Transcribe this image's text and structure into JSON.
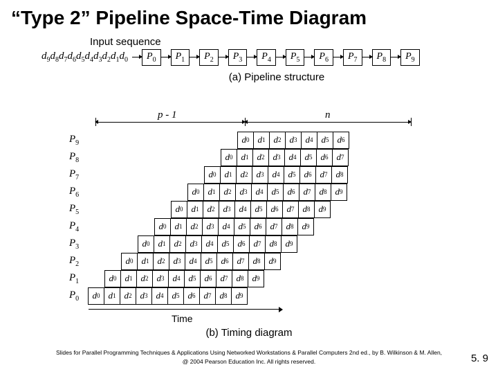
{
  "title": "“Type 2” Pipeline Space-Time Diagram",
  "partA": {
    "input_label": "Input sequence",
    "d_sequence": [
      "d9",
      "d8",
      "d7",
      "d6",
      "d5",
      "d4",
      "d3",
      "d2",
      "d1",
      "d0"
    ],
    "stages": [
      "P0",
      "P1",
      "P2",
      "P3",
      "P4",
      "P5",
      "P6",
      "P7",
      "P8",
      "P9"
    ],
    "caption": "(a) Pipeline structure"
  },
  "partB": {
    "dim_left_label": "p - 1",
    "dim_right_label": "n",
    "dim_split_col": 9,
    "dim_total_col": 19,
    "processors": [
      "P9",
      "P8",
      "P7",
      "P6",
      "P5",
      "P4",
      "P3",
      "P2",
      "P1",
      "P0"
    ],
    "rows": [
      {
        "offset": 9,
        "cells": [
          "d0",
          "d1",
          "d2",
          "d3",
          "d4",
          "d5",
          "d6"
        ]
      },
      {
        "offset": 8,
        "cells": [
          "d0",
          "d1",
          "d2",
          "d3",
          "d4",
          "d5",
          "d6",
          "d7"
        ]
      },
      {
        "offset": 7,
        "cells": [
          "d0",
          "d1",
          "d2",
          "d3",
          "d4",
          "d5",
          "d6",
          "d7",
          "d8"
        ]
      },
      {
        "offset": 6,
        "cells": [
          "d0",
          "d1",
          "d2",
          "d3",
          "d4",
          "d5",
          "d6",
          "d7",
          "d8",
          "d9"
        ]
      },
      {
        "offset": 5,
        "cells": [
          "d0",
          "d1",
          "d2",
          "d3",
          "d4",
          "d5",
          "d6",
          "d7",
          "d8",
          "d9"
        ]
      },
      {
        "offset": 4,
        "cells": [
          "d0",
          "d1",
          "d2",
          "d3",
          "d4",
          "d5",
          "d6",
          "d7",
          "d8",
          "d9"
        ]
      },
      {
        "offset": 3,
        "cells": [
          "d0",
          "d1",
          "d2",
          "d3",
          "d4",
          "d5",
          "d6",
          "d7",
          "d8",
          "d9"
        ]
      },
      {
        "offset": 2,
        "cells": [
          "d0",
          "d1",
          "d2",
          "d3",
          "d4",
          "d5",
          "d6",
          "d7",
          "d8",
          "d9"
        ]
      },
      {
        "offset": 1,
        "cells": [
          "d0",
          "d1",
          "d2",
          "d3",
          "d4",
          "d5",
          "d6",
          "d7",
          "d8",
          "d9"
        ]
      },
      {
        "offset": 0,
        "cells": [
          "d0",
          "d1",
          "d2",
          "d3",
          "d4",
          "d5",
          "d6",
          "d7",
          "d8",
          "d9"
        ]
      }
    ],
    "time_label": "Time",
    "caption": "(b) Timing diagram"
  },
  "footer_line1": "Slides for Parallel Programming Techniques & Applications Using Networked Workstations & Parallel Computers 2nd ed., by B. Wilkinson & M. Allen,",
  "footer_line2": "@ 2004 Pearson Education Inc. All rights reserved.",
  "page_number": "5. 9"
}
